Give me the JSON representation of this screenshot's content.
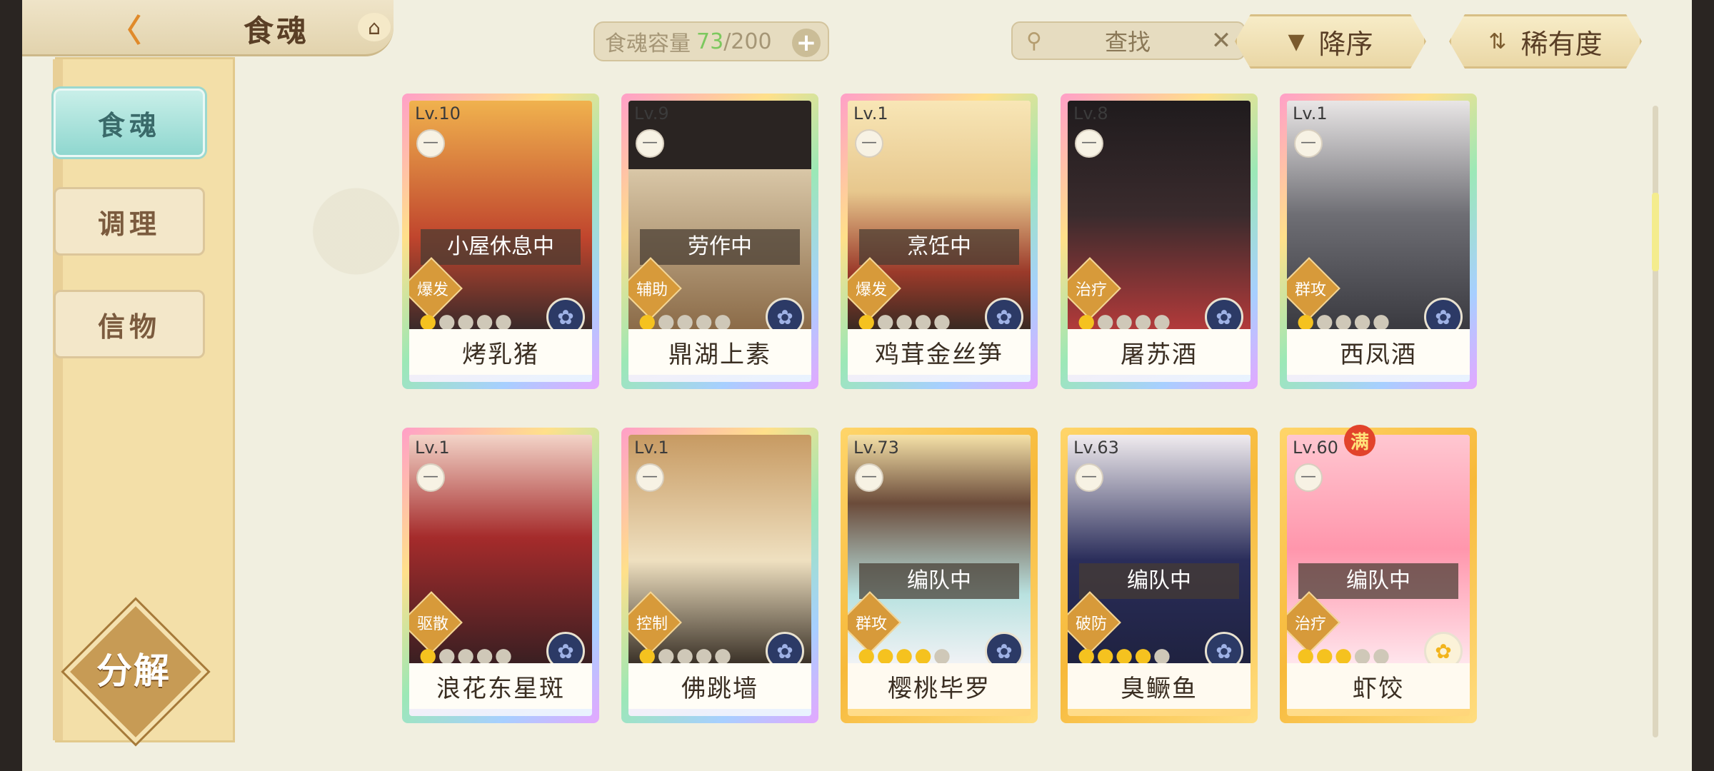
{
  "header": {
    "back_icon": "back-arrow-icon",
    "title": "食魂",
    "home_icon": "pavilion-icon",
    "capacity_label": "食魂容量",
    "capacity_current": "73",
    "capacity_total": "/200",
    "add_icon": "plus-icon",
    "search_label": "查找",
    "search_icon": "magnifier-icon",
    "clear_icon": "close-icon",
    "sort_order_label": "降序",
    "sort_field_label": "稀有度"
  },
  "sidebar": {
    "items": [
      {
        "label": "食魂",
        "active": true
      },
      {
        "label": "调理",
        "active": false
      },
      {
        "label": "信物",
        "active": false
      }
    ],
    "decompose_label": "分解"
  },
  "cards": [
    {
      "level": "Lv.10",
      "status": "小屋休息中",
      "role": "爆发",
      "stars": 1,
      "name": "烤乳猪",
      "frame": "rainbow"
    },
    {
      "level": "Lv.9",
      "status": "劳作中",
      "role": "辅助",
      "stars": 1,
      "name": "鼎湖上素",
      "frame": "rainbow"
    },
    {
      "level": "Lv.1",
      "status": "烹饪中",
      "role": "爆发",
      "stars": 1,
      "name": "鸡茸金丝笋",
      "frame": "rainbow"
    },
    {
      "level": "Lv.8",
      "status": "",
      "role": "治疗",
      "stars": 1,
      "name": "屠苏酒",
      "frame": "rainbow"
    },
    {
      "level": "Lv.1",
      "status": "",
      "role": "群攻",
      "stars": 1,
      "name": "西凤酒",
      "frame": "rainbow"
    },
    {
      "level": "Lv.1",
      "status": "",
      "role": "驱散",
      "stars": 1,
      "name": "浪花东星斑",
      "frame": "rainbow"
    },
    {
      "level": "Lv.1",
      "status": "",
      "role": "控制",
      "stars": 1,
      "name": "佛跳墙",
      "frame": "rainbow"
    },
    {
      "level": "Lv.73",
      "status": "编队中",
      "role": "群攻",
      "stars": 4,
      "name": "樱桃毕罗",
      "frame": "gold"
    },
    {
      "level": "Lv.63",
      "status": "编队中",
      "role": "破防",
      "stars": 4,
      "name": "臭鳜鱼",
      "frame": "gold"
    },
    {
      "level": "Lv.60",
      "status": "编队中",
      "role": "治疗",
      "stars": 3,
      "name": "虾饺",
      "frame": "gold",
      "badge": "满"
    }
  ],
  "colors": {
    "background": "#f1efe0",
    "accent_orange": "#e08a2a",
    "active_tab": "#8fd7cf",
    "capacity_current": "#7cc85e"
  }
}
